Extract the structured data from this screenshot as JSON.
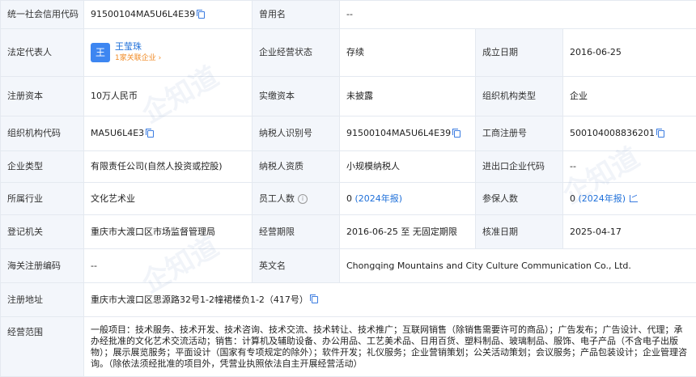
{
  "rows": {
    "r1": {
      "l1": "统一社会信用代码",
      "v1": "91500104MA5U6L4E39",
      "l2": "曾用名",
      "v2": "--"
    },
    "r2": {
      "l1": "法定代表人",
      "avatar": "王",
      "name": "王莹珠",
      "related": "1家关联企业 ›",
      "l2": "企业经营状态",
      "v2": "存续",
      "l3": "成立日期",
      "v3": "2016-06-25"
    },
    "r3": {
      "l1": "注册资本",
      "v1": "10万人民币",
      "l2": "实缴资本",
      "v2": "未披露",
      "l3": "组织机构类型",
      "v3": "企业"
    },
    "r4": {
      "l1": "组织机构代码",
      "v1": "MA5U6L4E3",
      "l2": "纳税人识别号",
      "v2": "91500104MA5U6L4E39",
      "l3": "工商注册号",
      "v3": "500104008836201"
    },
    "r5": {
      "l1": "企业类型",
      "v1": "有限责任公司(自然人投资或控股)",
      "l2": "纳税人资质",
      "v2": "小规模纳税人",
      "l3": "进出口企业代码",
      "v3": "--"
    },
    "r6": {
      "l1": "所属行业",
      "v1": "文化艺术业",
      "l2": "员工人数",
      "v2_num": "0",
      "v2_link": "(2024年报)",
      "l3": "参保人数",
      "v3_num": "0",
      "v3_link": "(2024年报)"
    },
    "r7": {
      "l1": "登记机关",
      "v1": "重庆市大渡口区市场监督管理局",
      "l2": "经营期限",
      "v2": "2016-06-25 至 无固定期限",
      "l3": "核准日期",
      "v3": "2025-04-17"
    },
    "r8": {
      "l1": "海关注册编码",
      "v1": "--",
      "l2": "英文名",
      "v2": "Chongqing Mountains and City Culture Communication Co., Ltd."
    },
    "r9": {
      "l1": "注册地址",
      "v1": "重庆市大渡口区思源路32号1-2幢裙楼负1-2（417号）"
    },
    "r10": {
      "l1": "经营范围",
      "v1": "一般项目：技术服务、技术开发、技术咨询、技术交流、技术转让、技术推广；互联网销售（除销售需要许可的商品）；广告发布；广告设计、代理；承办经批准的文化艺术交流活动；销售：计算机及辅助设备、办公用品、工艺美术品、日用百货、塑料制品、玻璃制品、服饰、电子产品（不含电子出版物）；展示展览服务；平面设计（国家有专项规定的除外）；软件开发；礼仪服务；企业营销策划；公关活动策划；会议服务；产品包装设计；企业管理咨询。（除依法须经批准的项目外，凭营业执照依法自主开展经营活动）"
    }
  },
  "watermark": "企知道",
  "colors": {
    "label_bg": "#f3f6fb",
    "border": "#e4e9f0",
    "link": "#1e6fd9",
    "accent_orange": "#f08a24",
    "avatar_bg": "#3d86f1"
  },
  "icons": [
    "copy-icon",
    "info-icon",
    "chart-icon"
  ]
}
